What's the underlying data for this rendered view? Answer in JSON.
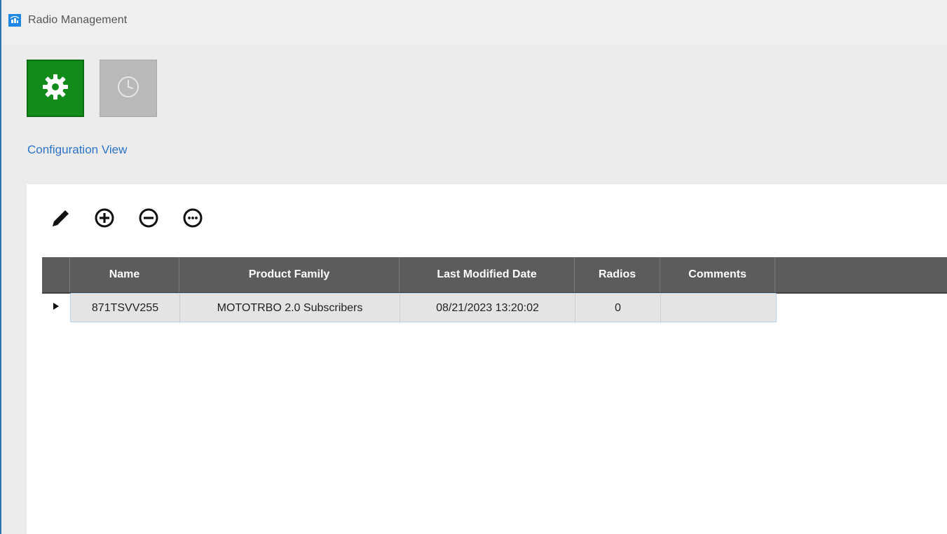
{
  "window": {
    "title": "Radio Management",
    "accent": "#2e75b6"
  },
  "nav": {
    "configuration_icon": "gear-icon",
    "history_icon": "clock-icon",
    "configuration_color": "#118c1a",
    "view_link": "Configuration View"
  },
  "toolbar": {
    "icons": [
      "pencil-icon",
      "plus-circle-icon",
      "minus-circle-icon",
      "more-circle-icon"
    ]
  },
  "grid": {
    "columns": [
      "Name",
      "Product Family",
      "Last Modified Date",
      "Radios",
      "Comments"
    ],
    "rows": [
      {
        "name": "871TSVV255",
        "product_family": "MOTOTRBO 2.0 Subscribers",
        "last_modified": "08/21/2023 13:20:02",
        "radios": "0",
        "comments": ""
      }
    ]
  }
}
